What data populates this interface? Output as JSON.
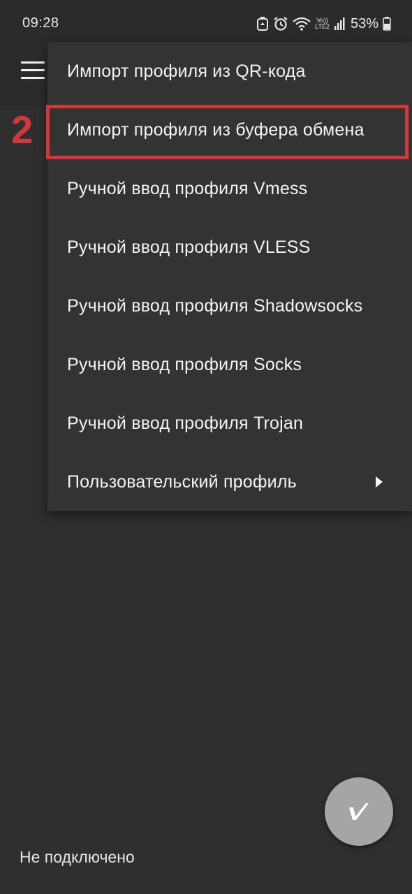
{
  "status_bar": {
    "time": "09:28",
    "battery_percent": "53%",
    "network_label_top": "Vo))",
    "network_label_bottom": "LTE2",
    "icons": [
      "recycle-icon",
      "alarm-icon",
      "wifi-icon",
      "volte-icon",
      "signal-icon",
      "battery-icon"
    ]
  },
  "toolbar": {
    "menu_icon": "hamburger-icon"
  },
  "menu": {
    "items": [
      {
        "label": "Импорт профиля из QR-кода"
      },
      {
        "label": "Импорт профиля из буфера обмена"
      },
      {
        "label": "Ручной ввод профиля Vmess"
      },
      {
        "label": "Ручной ввод профиля VLESS"
      },
      {
        "label": "Ручной ввод профиля Shadowsocks"
      },
      {
        "label": "Ручной ввод профиля Socks"
      },
      {
        "label": "Ручной ввод профиля Trojan"
      },
      {
        "label": "Пользовательский профиль",
        "has_submenu": true
      }
    ]
  },
  "annotation": {
    "step_number": "2",
    "color": "#d0383b"
  },
  "fab": {
    "icon": "v2ray-logo-icon"
  },
  "footer": {
    "connection_status": "Не подключено"
  },
  "colors": {
    "background": "#2f2f2f",
    "menu_background": "#333333",
    "fab_background": "#a5a5a5",
    "text": "#f4f4f4"
  }
}
